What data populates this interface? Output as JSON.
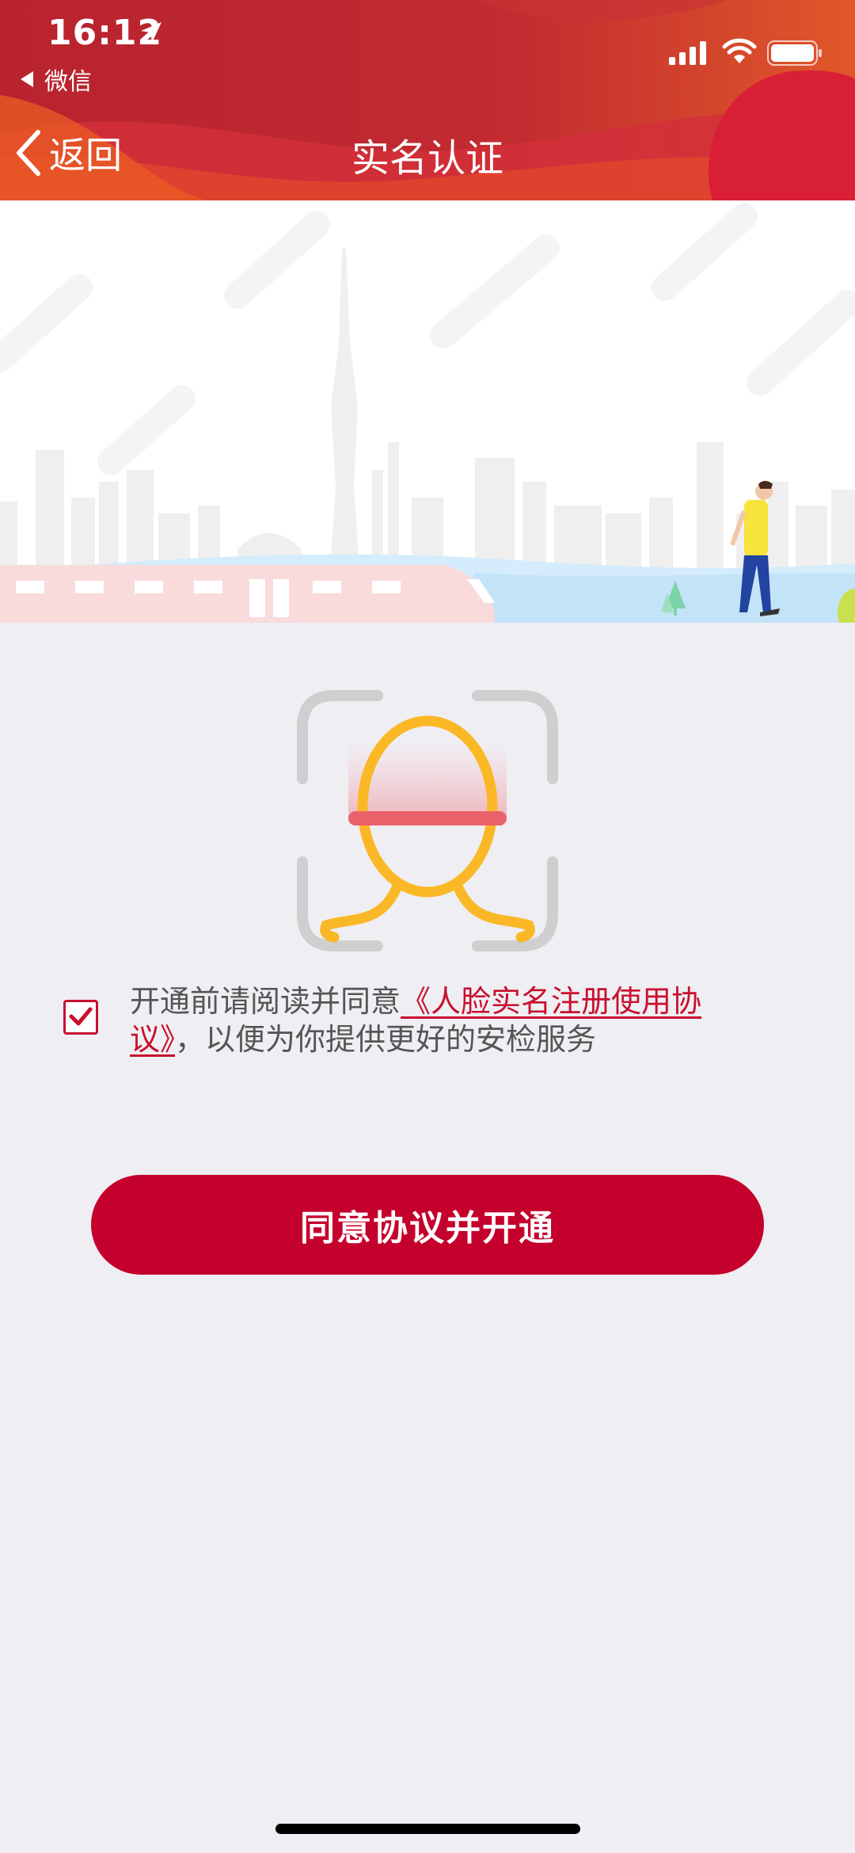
{
  "status_bar": {
    "time": "16:12",
    "back_to_app": "微信"
  },
  "nav": {
    "back_label": "返回",
    "title": "实名认证"
  },
  "agreement": {
    "checked": true,
    "prefix": "开通前请阅读并同意",
    "link_text": "《人脸实名注册使用协议》",
    "suffix": "，以便为你提供更好的安检服务"
  },
  "primary_button": {
    "label": "同意协议并开通"
  },
  "colors": {
    "brand_red": "#c4002c",
    "header_red": "#bd2631",
    "face_outline": "#fbb826",
    "scan_line": "#e96169",
    "frame_gray": "#cfcfcf",
    "page_bg": "#efeef3"
  },
  "icons": {
    "nav_back": "chevron-left-icon",
    "face_scan": "face-scan-icon",
    "checkbox": "checkmark-icon"
  }
}
